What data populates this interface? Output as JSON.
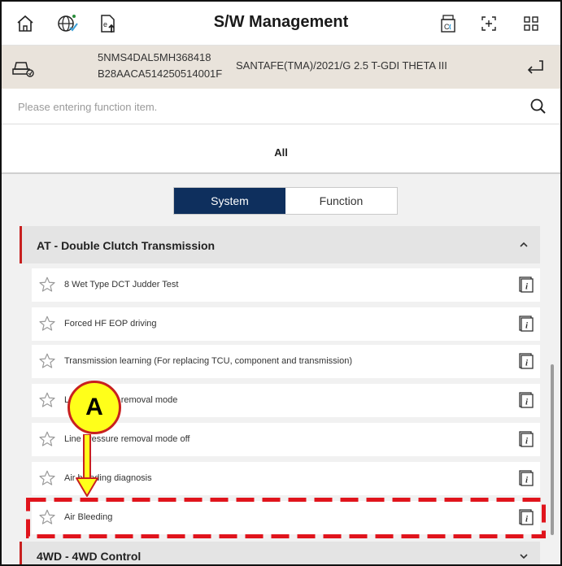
{
  "header": {
    "title": "S/W Management",
    "icons": [
      "home-icon",
      "globe-check-icon",
      "device-upload-icon",
      "ccu-icon",
      "expand-icon",
      "grid-menu-icon"
    ]
  },
  "vehicle": {
    "vin": "5NMS4DAL5MH368418",
    "sw_id": "B28AACA514250514001F",
    "model": "SANTAFE(TMA)/2021/G 2.5 T-GDI THETA III",
    "icons": [
      "car-diagnostic-icon",
      "return-icon"
    ]
  },
  "search": {
    "placeholder": "Please entering function item."
  },
  "tabs": {
    "all_label": "All"
  },
  "segment": {
    "system_label": "System",
    "function_label": "Function",
    "active": "System"
  },
  "groups": [
    {
      "label": "AT - Double Clutch Transmission",
      "expanded": true
    },
    {
      "label": "4WD - 4WD Control",
      "expanded": false
    }
  ],
  "items": [
    {
      "label": "8 Wet Type DCT Judder Test"
    },
    {
      "label": "Forced HF EOP driving"
    },
    {
      "label": "Transmission learning (For replacing TCU, component and transmission)"
    },
    {
      "label": "Line pressure removal mode"
    },
    {
      "label": "Line pressure removal mode off"
    },
    {
      "label": "Air bleeding diagnosis"
    },
    {
      "label": "Air Bleeding"
    }
  ],
  "annotation": {
    "callout_letter": "A"
  },
  "colors": {
    "accent_navy": "#0e2f5d",
    "group_marker_red": "#c8201f",
    "callout_yellow": "#ffff1a",
    "vehicle_bar_bg": "#e9e3db"
  }
}
